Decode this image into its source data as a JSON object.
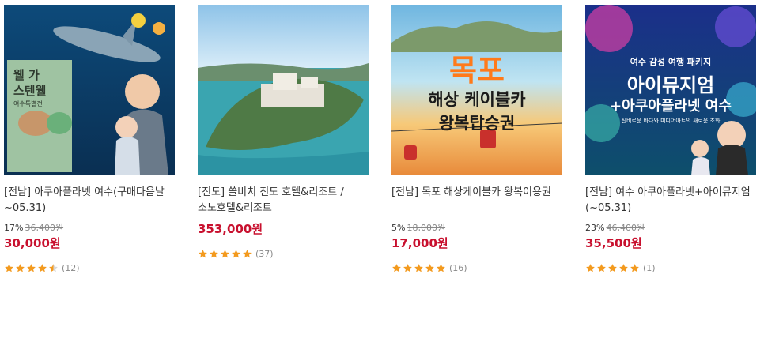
{
  "products": [
    {
      "title": "[전남] 아쿠아플라넷 여수(구매다음날~05.31)",
      "discount": "17%",
      "original_price": "36,400원",
      "price": "30,000원",
      "rating": 4.5,
      "review_count": "(12)",
      "image_overlay": {
        "line1": "웰 가",
        "line2": "스텐웰",
        "line3": "여수특별전"
      }
    },
    {
      "title": "[진도] 쏠비치 진도 호텔&리조트 / 소노호텔&리조트",
      "discount": "",
      "original_price": "",
      "price": "353,000원",
      "rating": 5,
      "review_count": "(37)",
      "image_overlay": {}
    },
    {
      "title": "[전남] 목포 해상케이블카 왕복이용권",
      "discount": "5%",
      "original_price": "18,000원",
      "price": "17,000원",
      "rating": 5,
      "review_count": "(16)",
      "image_overlay": {
        "line1": "목포",
        "line2": "해상 케이블카",
        "line3": "왕복탑승권"
      }
    },
    {
      "title": "[전남] 여수 아쿠아플라넷+아이뮤지엄 (~05.31)",
      "discount": "23%",
      "original_price": "46,400원",
      "price": "35,500원",
      "rating": 5,
      "review_count": "(1)",
      "image_overlay": {
        "line1": "여수 감성 여행 패키지",
        "line2": "아이뮤지엄",
        "line3": "+아쿠아플라넷 여수",
        "line4": "신비로운 바다와 미디어아트의 새로운 조화"
      }
    }
  ],
  "colors": {
    "price": "#c8102e",
    "star": "#f39a1e",
    "star_empty": "#d8d8d8"
  }
}
